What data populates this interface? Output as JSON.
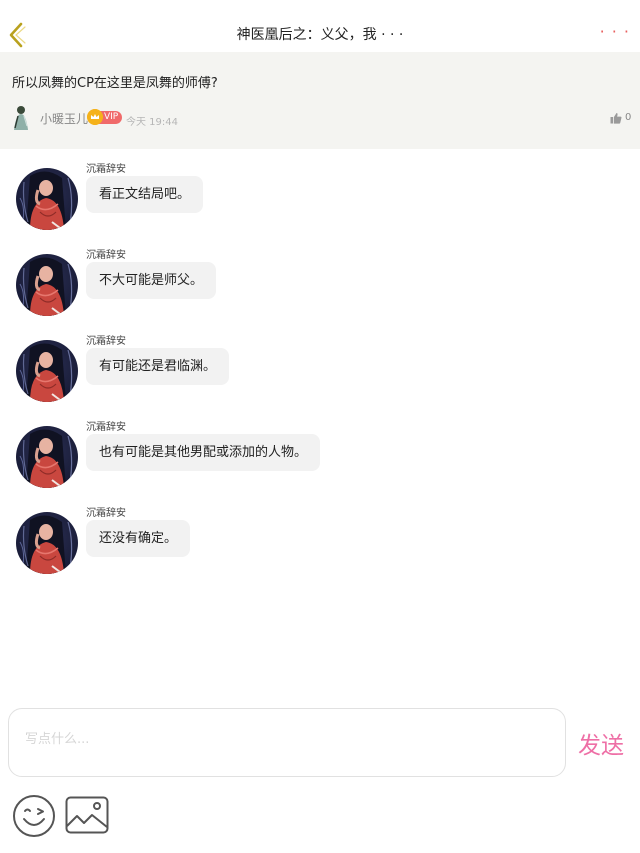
{
  "header": {
    "title": "神医凰后之：义父，我 · · ·",
    "more_label": "· · ·",
    "back_icon": "chevron-left-icon",
    "accent_color": "#e8605f",
    "back_color": "#b9a11e"
  },
  "post": {
    "text": "所以凤舞的CP在这里是凤舞的师傅?",
    "author": "小暖玉儿",
    "badge": "VIP",
    "time": "今天 19:44",
    "likes": "0"
  },
  "messages": [
    {
      "sender": "沉霜辞安",
      "text": "看正文结局吧。"
    },
    {
      "sender": "沉霜辞安",
      "text": "不大可能是师父。"
    },
    {
      "sender": "沉霜辞安",
      "text": "有可能还是君临渊。"
    },
    {
      "sender": "沉霜辞安",
      "text": "也有可能是其他男配或添加的人物。"
    },
    {
      "sender": "沉霜辞安",
      "text": "还没有确定。"
    }
  ],
  "composer": {
    "placeholder": "写点什么...",
    "send_label": "发送",
    "send_color": "#ee6fa6"
  }
}
